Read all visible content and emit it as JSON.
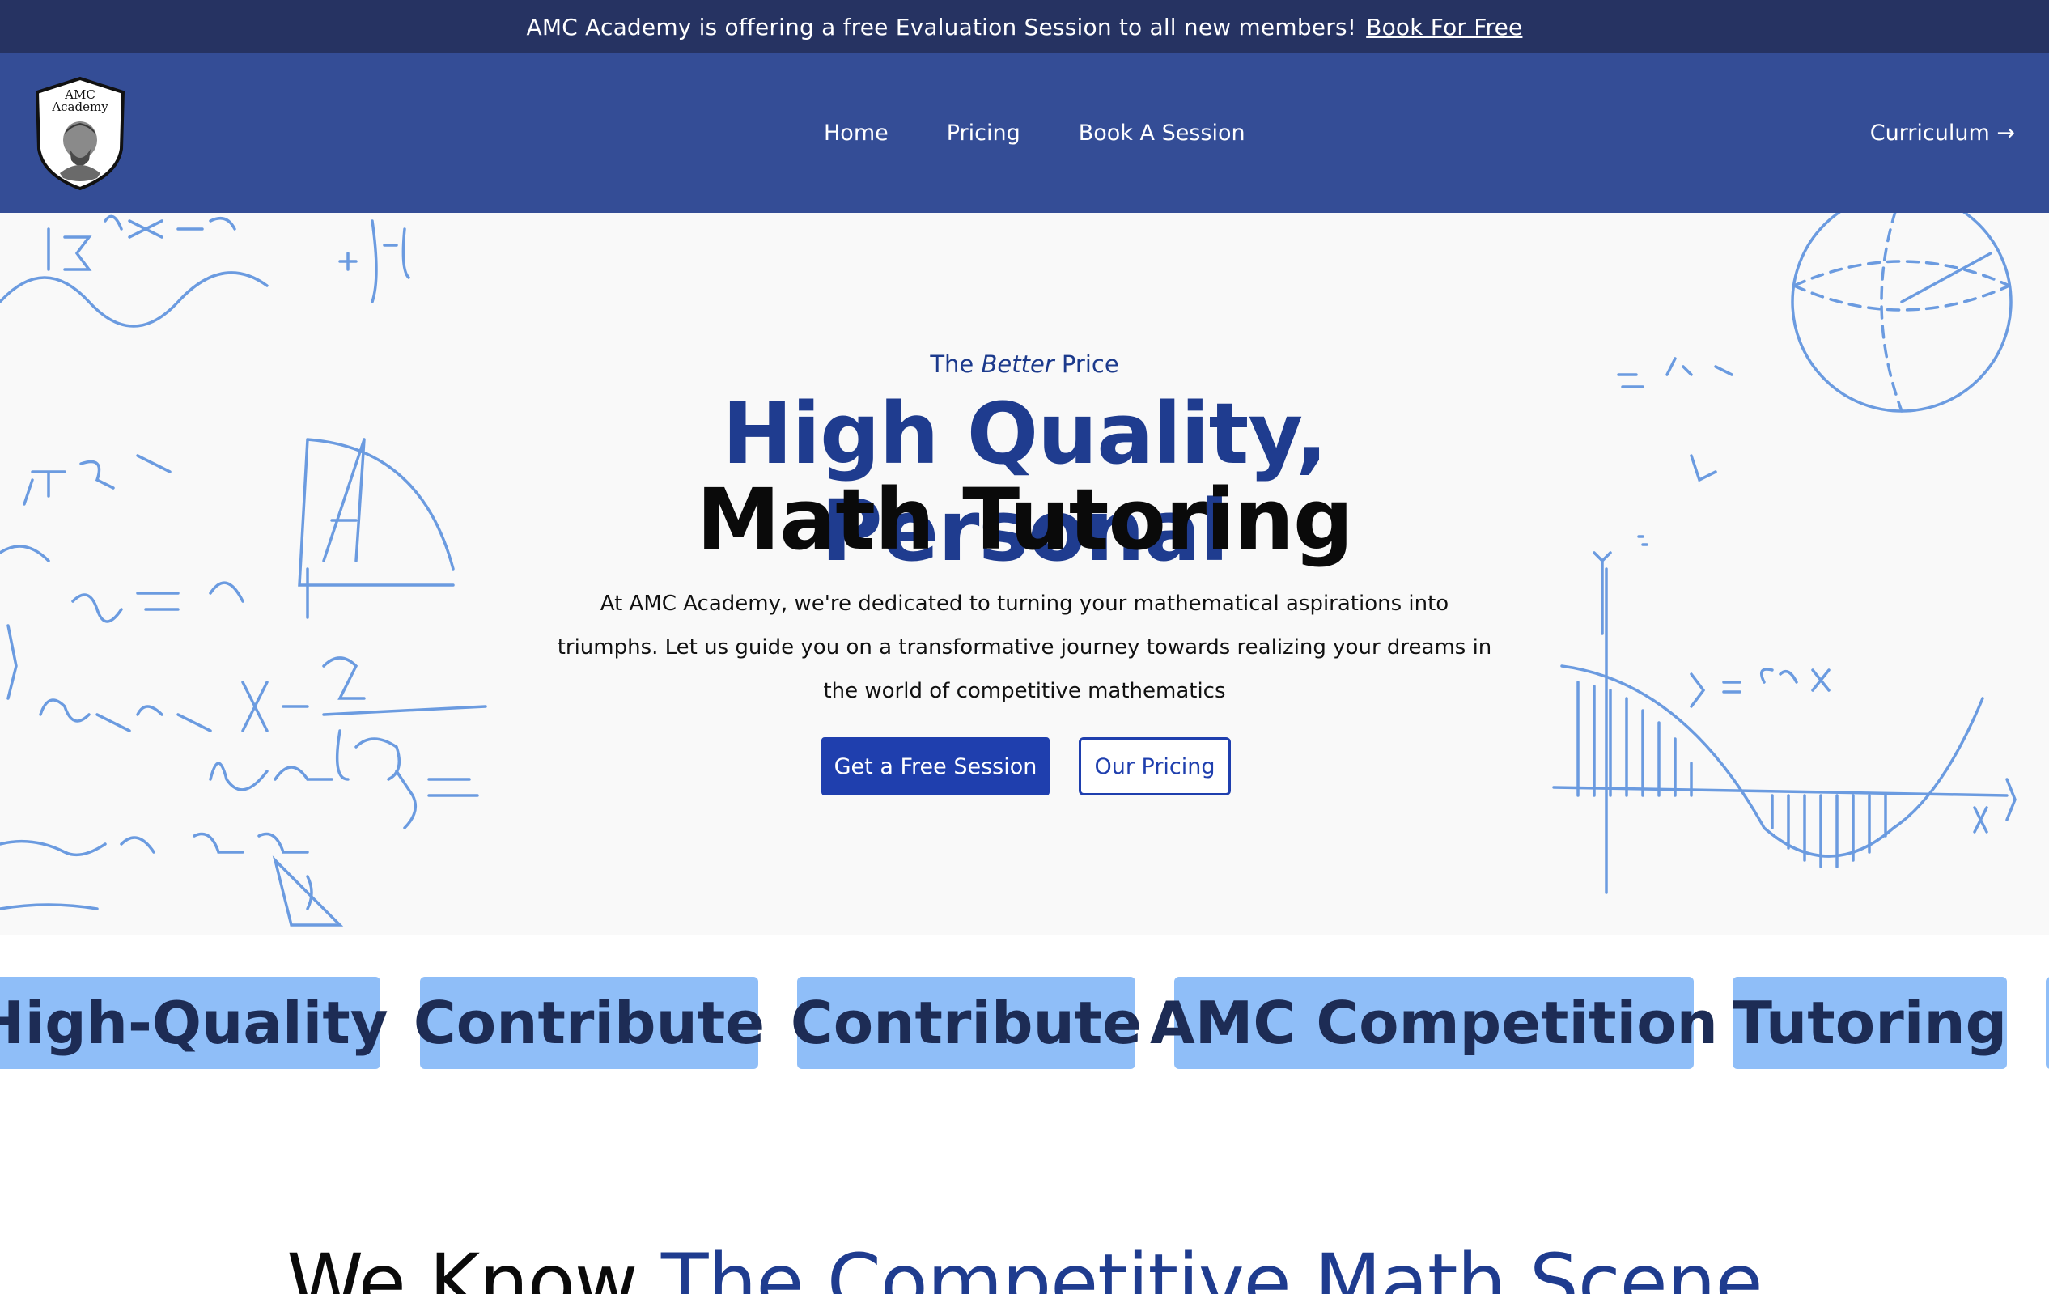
{
  "announcement": {
    "text": "AMC Academy is offering a free Evaluation Session to all new members!",
    "link": "Book For Free"
  },
  "nav": {
    "logo": {
      "line1": "AMC",
      "line2": "Academy"
    },
    "links": [
      "Home",
      "Pricing",
      "Book A Session"
    ],
    "cta": "Curriculum →"
  },
  "hero": {
    "eyebrow_pre": "The ",
    "eyebrow_em": "Better",
    "eyebrow_post": " Price",
    "headline_line1": "High Quality, Personal",
    "headline_line2": "Math Tutoring",
    "description": "At AMC Academy, we're dedicated to turning your mathematical aspirations into triumphs. Let us guide you on a transformative journey towards realizing your dreams in the world of competitive mathematics",
    "primary_button": "Get a Free Session",
    "secondary_button": "Our Pricing"
  },
  "marquee": {
    "items": [
      "High-Quality",
      "Contribute",
      "Contribute",
      "AMC Competition",
      "Tutoring"
    ]
  },
  "section": {
    "heading_plain": "We Know ",
    "heading_accent": "The Competitive Math Scene"
  },
  "colors": {
    "announcement_bg": "#263362",
    "nav_bg": "#344d96",
    "accent_blue": "#1f3fae",
    "headline_blue": "#1f3c8f",
    "chip_bg": "#8fbef8",
    "doodle_blue": "#6b9be0"
  }
}
